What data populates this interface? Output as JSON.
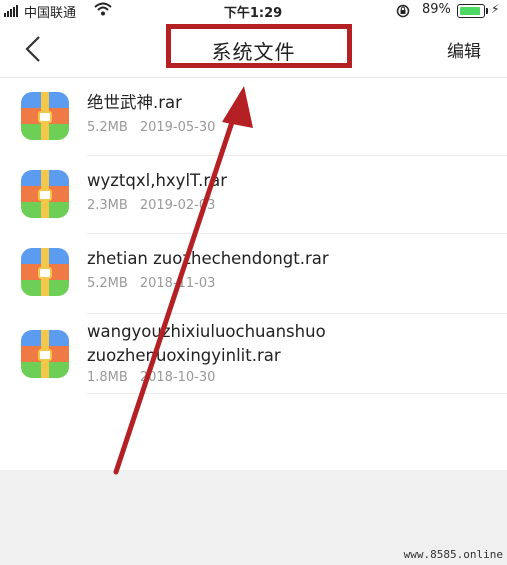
{
  "status_bar": {
    "carrier": "中国联通",
    "time": "下午1:29",
    "battery_percent": "89%",
    "battery_level": 0.89,
    "icons": [
      "signal-icon",
      "wifi-icon",
      "orientation-lock-icon",
      "battery-icon",
      "charging-icon"
    ]
  },
  "nav": {
    "title": "系统文件",
    "edit_label": "编辑",
    "back_icon": "chevron-left-icon"
  },
  "files": [
    {
      "name_lines": [
        "绝世武神.rar"
      ],
      "size": "5.2MB",
      "date": "2019-05-30",
      "icon": "archive-icon"
    },
    {
      "name_lines": [
        "wyztqxl,hxylT.rar"
      ],
      "size": "2.3MB",
      "date": "2019-02-03",
      "icon": "archive-icon"
    },
    {
      "name_lines": [
        "zhetian zuozhechendongt.rar"
      ],
      "size": "5.2MB",
      "date": "2018-11-03",
      "icon": "archive-icon"
    },
    {
      "name_lines": [
        "wangyouzhixiuluochuanshuo",
        "zuozhenuoxingyinlit.rar"
      ],
      "size": "1.8MB",
      "date": "2018-10-30",
      "icon": "archive-icon"
    }
  ],
  "watermark": "www.8585.online",
  "colors": {
    "annotation_red": "#b52025",
    "background_gray": "#f0f0f0",
    "meta_text": "#999999"
  }
}
